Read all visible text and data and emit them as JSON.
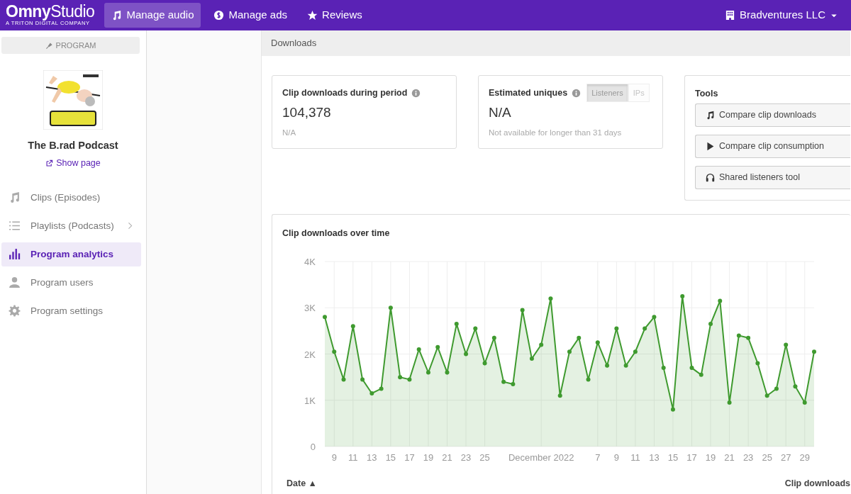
{
  "navbar": {
    "logo": "**Omny**Studio",
    "tagline": "A TRITON DIGITAL COMPANY",
    "tabs": [
      {
        "label": "Manage audio",
        "selected": true
      },
      {
        "label": "Manage ads",
        "selected": false
      },
      {
        "label": "Reviews",
        "selected": false
      }
    ],
    "account": "Bradventures LLC"
  },
  "sidebar": {
    "section_button": "PROGRAM",
    "program_title": "The B.rad Podcast",
    "show_page_link": "Show page",
    "items": [
      {
        "label": "Clips (Episodes)",
        "selected": false,
        "has_submenu": false
      },
      {
        "label": "Playlists (Podcasts)",
        "selected": false,
        "has_submenu": true
      },
      {
        "label": "Program analytics",
        "selected": true,
        "has_submenu": false
      },
      {
        "label": "Program users",
        "selected": false,
        "has_submenu": false
      },
      {
        "label": "Program settings",
        "selected": false,
        "has_submenu": false
      }
    ]
  },
  "page_header": {
    "title": "Downloads"
  },
  "stat_cards": [
    {
      "title": "Clip downloads during period",
      "value": "104,378",
      "note": "N/A"
    },
    {
      "title": "Estimated uniques",
      "value": "N/A",
      "note": "Not available for longer than 31 days",
      "toggle": [
        {
          "label": "Listeners",
          "selected": true
        },
        {
          "label": "IPs",
          "selected": false
        }
      ]
    }
  ],
  "tools": {
    "title": "Tools",
    "buttons": [
      "Compare clip downloads",
      "Compare clip consumption",
      "Shared listeners tool"
    ]
  },
  "chart_card": {
    "title": "Clip downloads over time",
    "chart_data": {
      "type": "area",
      "x": [
        "2022-11-08",
        "2022-11-09",
        "2022-11-10",
        "2022-11-11",
        "2022-11-12",
        "2022-11-13",
        "2022-11-14",
        "2022-11-15",
        "2022-11-16",
        "2022-11-17",
        "2022-11-18",
        "2022-11-19",
        "2022-11-20",
        "2022-11-21",
        "2022-11-22",
        "2022-11-23",
        "2022-11-24",
        "2022-11-25",
        "2022-11-26",
        "2022-11-27",
        "2022-11-28",
        "2022-11-29",
        "2022-11-30",
        "2022-12-01",
        "2022-12-02",
        "2022-12-03",
        "2022-12-04",
        "2022-12-05",
        "2022-12-06",
        "2022-12-07",
        "2022-12-08",
        "2022-12-09",
        "2022-12-10",
        "2022-12-11",
        "2022-12-12",
        "2022-12-13",
        "2022-12-14",
        "2022-12-15",
        "2022-12-16",
        "2022-12-17",
        "2022-12-18",
        "2022-12-19",
        "2022-12-20",
        "2022-12-21",
        "2022-12-22",
        "2022-12-23",
        "2022-12-24",
        "2022-12-25",
        "2022-12-26",
        "2022-12-27",
        "2022-12-28",
        "2022-12-29",
        "2022-12-30"
      ],
      "series": [
        {
          "color": "#3f9a2f",
          "values": [
            2800,
            2050,
            1450,
            2600,
            1450,
            1150,
            1250,
            3000,
            1500,
            1450,
            2100,
            1600,
            2150,
            1600,
            2650,
            2000,
            2550,
            1800,
            2350,
            1400,
            1350,
            2950,
            1900,
            2200,
            3200,
            1100,
            2050,
            2350,
            1450,
            2250,
            1750,
            2550,
            1750,
            2050,
            2550,
            2800,
            1700,
            800,
            3250,
            1700,
            1550,
            2650,
            3150,
            950,
            2400,
            2350,
            1800,
            1100,
            1250,
            2200,
            1300,
            950,
            2050
          ]
        }
      ],
      "xlim": [
        "2022-11-08",
        "2022-12-30"
      ],
      "ylim": [
        0,
        4000
      ],
      "grid": true,
      "yticks": [
        {
          "value": 0,
          "label": "0"
        },
        {
          "value": 1000,
          "label": "1K"
        },
        {
          "value": 2000,
          "label": "2K"
        },
        {
          "value": 3000,
          "label": "3K"
        },
        {
          "value": 4000,
          "label": "4K"
        }
      ],
      "xticks": [
        {
          "value": "2022-11-09",
          "label": "9"
        },
        {
          "value": "2022-11-11",
          "label": "11"
        },
        {
          "value": "2022-11-13",
          "label": "13"
        },
        {
          "value": "2022-11-15",
          "label": "15"
        },
        {
          "value": "2022-11-17",
          "label": "17"
        },
        {
          "value": "2022-11-19",
          "label": "19"
        },
        {
          "value": "2022-11-21",
          "label": "21"
        },
        {
          "value": "2022-11-23",
          "label": "23"
        },
        {
          "value": "2022-11-25",
          "label": "25"
        },
        {
          "value": "2022-12-01",
          "label": "December 2022"
        },
        {
          "value": "2022-12-07",
          "label": "7"
        },
        {
          "value": "2022-12-09",
          "label": "9"
        },
        {
          "value": "2022-12-11",
          "label": "11"
        },
        {
          "value": "2022-12-13",
          "label": "13"
        },
        {
          "value": "2022-12-15",
          "label": "15"
        },
        {
          "value": "2022-12-17",
          "label": "17"
        },
        {
          "value": "2022-12-19",
          "label": "19"
        },
        {
          "value": "2022-12-21",
          "label": "21"
        },
        {
          "value": "2022-12-23",
          "label": "23"
        },
        {
          "value": "2022-12-25",
          "label": "25"
        },
        {
          "value": "2022-12-27",
          "label": "27"
        },
        {
          "value": "2022-12-29",
          "label": "29"
        }
      ]
    }
  },
  "table": {
    "columns": [
      "Date ▲",
      "Clip downloads"
    ]
  }
}
